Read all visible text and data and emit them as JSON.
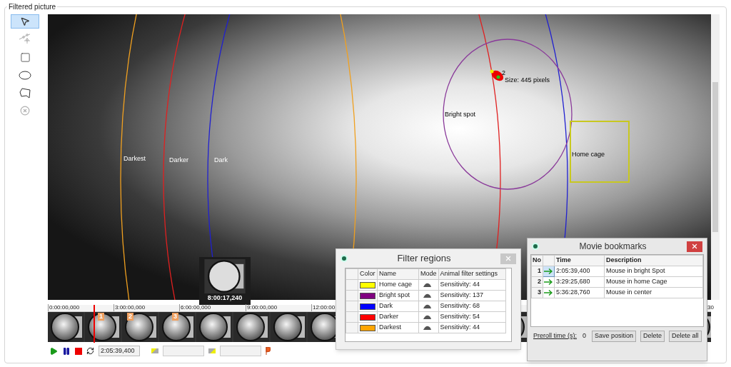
{
  "panel": {
    "title": "Filtered picture"
  },
  "tools": [
    {
      "kind": "pointer",
      "selected": true,
      "disabled": false
    },
    {
      "kind": "nodes",
      "selected": false,
      "disabled": true
    },
    {
      "kind": "rectangle",
      "selected": false,
      "disabled": false
    },
    {
      "kind": "ellipse",
      "selected": false,
      "disabled": false
    },
    {
      "kind": "polygon",
      "selected": false,
      "disabled": false
    },
    {
      "kind": "delete",
      "selected": false,
      "disabled": true
    }
  ],
  "video": {
    "regions": [
      {
        "kind": "ring",
        "label": "Darkest",
        "color": "#f0a020"
      },
      {
        "kind": "ring",
        "label": "Darker",
        "color": "#e02020"
      },
      {
        "kind": "ring",
        "label": "Dark",
        "color": "#2020d0"
      },
      {
        "kind": "ellipse",
        "label": "Bright spot",
        "color": "#8a3a9a"
      },
      {
        "kind": "rect",
        "label": "Home cage",
        "color": "#c8c820"
      }
    ],
    "animal": {
      "id": "2",
      "size": "Size: 445 pixels"
    }
  },
  "preview": {
    "time": "8:00:17,240"
  },
  "timeline": {
    "ticks": [
      "0:00:00,000",
      "3:00:00,000",
      "6:00:00,000",
      "9:00:00,000",
      "12:00:00",
      "30"
    ],
    "markers": [
      {
        "label": "1"
      },
      {
        "label": "2"
      },
      {
        "label": "3"
      }
    ]
  },
  "playback": {
    "time": "2:05:39,400"
  },
  "filter_regions": {
    "title": "Filter regions",
    "columns": [
      "Color",
      "Name",
      "Mode",
      "Animal filter settings"
    ],
    "rows": [
      {
        "color": "#ffff00",
        "name": "Home cage",
        "setting": "Sensitivity: 44"
      },
      {
        "color": "#800080",
        "name": "Bright spot",
        "setting": "Sensitivity: 137"
      },
      {
        "color": "#0000ff",
        "name": "Dark",
        "setting": "Sensitivity: 68"
      },
      {
        "color": "#ff0000",
        "name": "Darker",
        "setting": "Sensitivity: 54"
      },
      {
        "color": "#ffa500",
        "name": "Darkest",
        "setting": "Sensitivity: 44"
      }
    ]
  },
  "bookmarks": {
    "title": "Movie bookmarks",
    "columns": [
      "No",
      "Time",
      "Description"
    ],
    "rows": [
      {
        "no": "1",
        "time": "2:05:39,400",
        "description": "Mouse in bright Spot",
        "selected": true
      },
      {
        "no": "2",
        "time": "3:29:25,680",
        "description": "Mouse in home Cage",
        "selected": false
      },
      {
        "no": "3",
        "time": "5:36:28,760",
        "description": "Mouse in center",
        "selected": false
      }
    ],
    "preroll_label": "Preroll time (s):",
    "preroll_value": "0",
    "buttons": [
      "Save position",
      "Delete",
      "Delete all"
    ]
  }
}
